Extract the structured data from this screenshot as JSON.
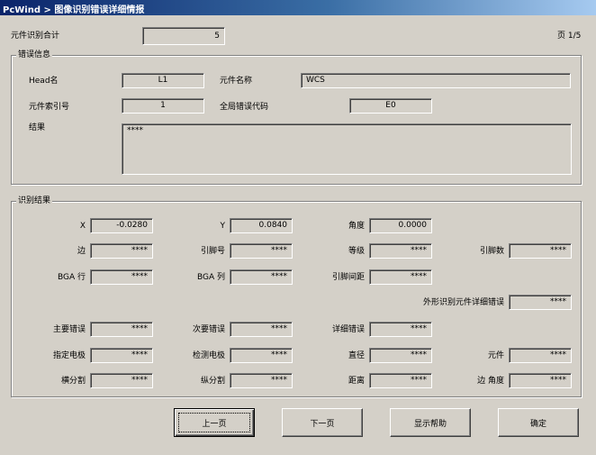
{
  "title": "PcWind > 图像识别错误详细情报",
  "component_total": {
    "label": "元件识别合计",
    "value": "5"
  },
  "page": "页 1/5",
  "error_info": {
    "group_title": "错误信息",
    "head_label": "Head名",
    "head_value": "L1",
    "comp_name_label": "元件名称",
    "comp_name_value": "WCS",
    "comp_index_label": "元件索引号",
    "comp_index_value": "1",
    "global_code_label": "全局错误代码",
    "global_code_value": "E0",
    "result_label": "结果",
    "result_value": "****"
  },
  "recog": {
    "group_title": "识别结果",
    "x_label": "X",
    "x_value": "-0.0280",
    "y_label": "Y",
    "y_value": "0.0840",
    "angle_label": "角度",
    "angle_value": "0.0000",
    "edge_label": "边",
    "edge_value": "****",
    "pin_no_label": "引脚号",
    "pin_no_value": "****",
    "grade_label": "等级",
    "grade_value": "****",
    "pin_count_label": "引脚数",
    "pin_count_value": "****",
    "bga_row_label": "BGA 行",
    "bga_row_value": "****",
    "bga_col_label": "BGA 列",
    "bga_col_value": "****",
    "pin_pitch_label": "引脚间距",
    "pin_pitch_value": "****",
    "outline_err_label": "外形识别元件详细错误",
    "outline_err_value": "****",
    "main_err_label": "主要错误",
    "main_err_value": "****",
    "sub_err_label": "次要错误",
    "sub_err_value": "****",
    "detail_err_label": "详细错误",
    "detail_err_value": "****",
    "spec_elec_label": "指定电极",
    "spec_elec_value": "****",
    "detect_elec_label": "检测电极",
    "detect_elec_value": "****",
    "diameter_label": "直径",
    "diameter_value": "****",
    "component_label": "元件",
    "component_value": "****",
    "horiz_split_label": "横分割",
    "horiz_split_value": "****",
    "vert_split_label": "纵分割",
    "vert_split_value": "****",
    "distance_label": "距离",
    "distance_value": "****",
    "edge_angle_label": "边 角度",
    "edge_angle_value": "****"
  },
  "buttons": {
    "prev": "上一页",
    "next": "下一页",
    "help": "显示帮助",
    "ok": "确定"
  }
}
